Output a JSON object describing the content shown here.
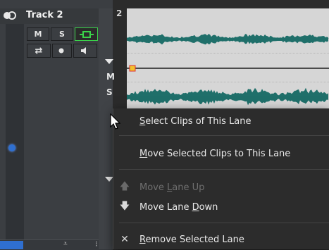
{
  "track": {
    "name": "Track 2",
    "lane_number": "2",
    "buttons": {
      "mute": "M",
      "solo": "S"
    },
    "lane_labels": {
      "mute": "M",
      "solo": "S"
    }
  },
  "context_menu": {
    "items": [
      {
        "label": "Select Clips of This Lane",
        "mnemonic": "S",
        "rest": "elect Clips of This Lane",
        "enabled": true
      },
      {
        "label": "Move Selected Clips to This Lane",
        "mnemonic": "M",
        "rest": "ove Selected Clips to This Lane",
        "enabled": true
      },
      {
        "label": "Move Lane Up",
        "prefix": "Move ",
        "mnemonic": "L",
        "rest": "ane Up",
        "enabled": false,
        "icon": "arrow-up-icon"
      },
      {
        "label": "Move Lane Down",
        "prefix": "Move Lane ",
        "mnemonic": "D",
        "rest": "own",
        "enabled": true,
        "icon": "arrow-down-icon"
      },
      {
        "label": "Remove Selected Lane",
        "mnemonic": "R",
        "rest": "emove Selected Lane",
        "enabled": true,
        "icon": "close-icon"
      }
    ]
  },
  "colors": {
    "waveform": "#1f6f6a",
    "monitor_active": "#3ad24a",
    "selection_blue": "#2f6fd0",
    "timeline_bg": "#d6d6d6"
  }
}
